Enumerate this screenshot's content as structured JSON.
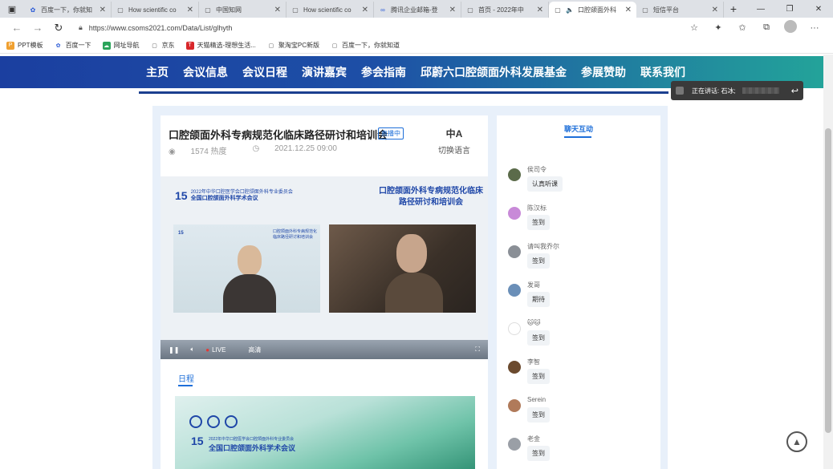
{
  "browser": {
    "tabs": [
      {
        "icon": "paw-icon",
        "title": "百度一下，你就知",
        "active": false
      },
      {
        "icon": "page-icon",
        "title": "How scientific co",
        "active": false
      },
      {
        "icon": "page-icon",
        "title": "中国知网",
        "active": false
      },
      {
        "icon": "page-icon",
        "title": "How scientific co",
        "active": false
      },
      {
        "icon": "link-icon",
        "title": "腾讯企业邮箱-登",
        "active": false
      },
      {
        "icon": "page-icon",
        "title": "首页 - 2022年中",
        "active": false
      },
      {
        "icon": "speaker-icon",
        "title": "口腔颌面外科",
        "active": true
      },
      {
        "icon": "page-icon",
        "title": "短信平台",
        "active": false
      }
    ],
    "url": "https://www.csoms2021.com/Data/List/glhyth",
    "bookmarks": [
      "PPT模板",
      "百度一下",
      "网址导航",
      "京东",
      "天猫精选-理想生活...",
      "聚淘宝PC新版",
      "百度一下，你就知道"
    ]
  },
  "site": {
    "nav": [
      "主页",
      "会议信息",
      "会议日程",
      "演讲嘉宾",
      "参会指南",
      "邱蔚六口腔颌面外科发展基金",
      "参展赞助",
      "联系我们"
    ],
    "speaking": {
      "label": "正在讲话: 石冰;"
    }
  },
  "video": {
    "title": "口腔颌面外科专病规范化临床路径研讨和培训会",
    "status": "直播中",
    "views": "1574 热度",
    "date": "2021.12.25 09:00",
    "switch_language": "切换语言",
    "bg_title": "口腔颌面外科专病规范化临床路径研讨和培训会",
    "logo_num": "15",
    "logo_line1": "2022年中华口腔医学会口腔颌面外科专业委员会",
    "logo_line2": "全国口腔颌面外科学术会议",
    "pane_text": "口腔颌面外科专病规范化临床路径研讨和培训会",
    "controls": {
      "live": "LIVE",
      "quality": "高清"
    }
  },
  "schedule": {
    "tab": "日程",
    "banner_num": "15",
    "banner_small": "2022年中华口腔医学会口腔颌面外科专业委员会",
    "banner_big": "全国口腔颌面外科学术会议"
  },
  "chat": {
    "title": "聊天互动",
    "messages": [
      {
        "name": "侯司令",
        "text": "认真听课",
        "color": "#5b6b4a"
      },
      {
        "name": "陈汉标",
        "text": "签到",
        "color": "#c88ad8"
      },
      {
        "name": "请叫我乔尔",
        "text": "签到",
        "color": "#8a8f96"
      },
      {
        "name": "发哥",
        "text": "期待",
        "color": "#6a8fb8"
      },
      {
        "name": "🐱🐱",
        "text": "签到",
        "color": "#ffffff"
      },
      {
        "name": "李智",
        "text": "签到",
        "color": "#6b4a2e"
      },
      {
        "name": "Serein",
        "text": "签到",
        "color": "#b07a5a"
      },
      {
        "name": "老金",
        "text": "签到",
        "color": "#9a9fa6"
      }
    ]
  }
}
